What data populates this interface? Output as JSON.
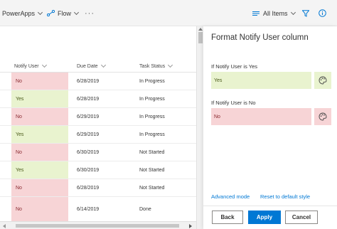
{
  "commandbar": {
    "powerapps": "PowerApps",
    "flow": "Flow",
    "more": "···",
    "view": "All Items"
  },
  "list": {
    "headers": {
      "notify_user": "Notify User",
      "due_date": "Due Date",
      "task_status": "Task Status"
    },
    "rows": [
      {
        "notify": "No",
        "due": "6/28/2019",
        "status": "In Progress"
      },
      {
        "notify": "Yes",
        "due": "6/28/2019",
        "status": "In Progress"
      },
      {
        "notify": "No",
        "due": "6/29/2019",
        "status": "In Progress"
      },
      {
        "notify": "Yes",
        "due": "6/29/2019",
        "status": "In Progress"
      },
      {
        "notify": "No",
        "due": "6/30/2019",
        "status": "Not Started"
      },
      {
        "notify": "Yes",
        "due": "6/30/2019",
        "status": "Not Started"
      },
      {
        "notify": "No",
        "due": "6/28/2019",
        "status": "Not Started"
      },
      {
        "notify": "No",
        "due": "6/14/2019",
        "status": "Done"
      }
    ]
  },
  "panel": {
    "title": "Format Notify User column",
    "yes_label": "If Notify User is Yes",
    "yes_value": "Yes",
    "no_label": "If Notify User is No",
    "no_value": "No",
    "advanced_mode": "Advanced mode",
    "reset": "Reset to default style",
    "back": "Back",
    "apply": "Apply",
    "cancel": "Cancel"
  },
  "colors": {
    "yes_fill": "#e9f3cf",
    "no_fill": "#f7d4d6",
    "accent": "#0078d4"
  },
  "icons": [
    "powerapps-chevron-icon",
    "flow-icon",
    "more-icon",
    "view-lines-icon",
    "filter-icon",
    "info-icon",
    "palette-icon"
  ]
}
